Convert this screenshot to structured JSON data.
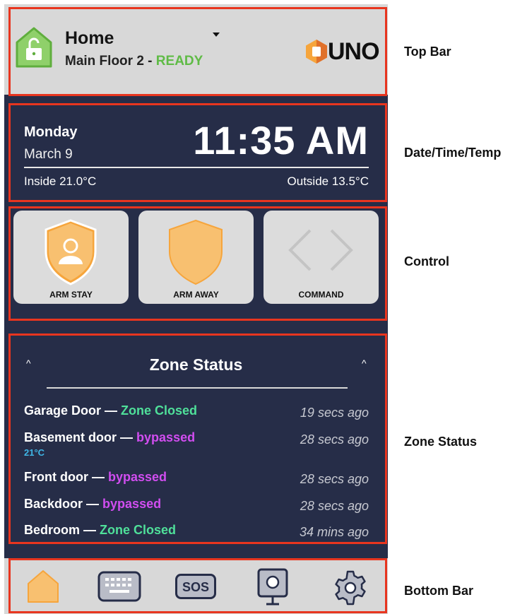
{
  "top_bar": {
    "location": "Home",
    "floor": "Main Floor 2",
    "separator": " - ",
    "status": "READY",
    "logo_text": "UNO",
    "lock_icon": "unlocked-home-icon",
    "accent_green": "#5fbb46"
  },
  "datetime": {
    "day": "Monday",
    "date": "March 9",
    "time": "11:35 AM",
    "inside": "Inside 21.0°C",
    "outside": "Outside 13.5°C"
  },
  "controls": [
    {
      "label": "ARM STAY",
      "icon": "shield-person-icon"
    },
    {
      "label": "ARM AWAY",
      "icon": "shield-icon"
    },
    {
      "label": "COMMAND",
      "icon": "chevrons-icon"
    }
  ],
  "zone_status": {
    "title": "Zone Status",
    "caret": "^",
    "rows": [
      {
        "name": "Garage Door",
        "dash": " — ",
        "status": "Zone Closed",
        "time": "19 secs ago"
      },
      {
        "name": "Basement door",
        "dash": " — ",
        "status": "bypassed",
        "time": "28 secs ago",
        "sub": "21°C"
      },
      {
        "name": "Front door",
        "dash": " — ",
        "status": "bypassed",
        "time": "28 secs ago"
      },
      {
        "name": "Backdoor",
        "dash": " — ",
        "status": "bypassed",
        "time": "28 secs ago"
      },
      {
        "name": "Bedroom",
        "dash": " — ",
        "status": "Zone Closed",
        "time": "34 mins ago"
      }
    ]
  },
  "bottom_bar": {
    "items": [
      "home-icon",
      "keypad-icon",
      "sos-icon",
      "camera-icon",
      "settings-icon"
    ],
    "sos_label": "SOS"
  },
  "callouts": {
    "top_bar": "Top Bar",
    "datetime": "Date/Time/Temp",
    "control": "Control",
    "zone_status": "Zone Status",
    "bottom_bar": "Bottom Bar"
  },
  "colors": {
    "panel_bg": "#262d48",
    "bar_bg": "#d8d8d8",
    "highlight_red": "#e8351f",
    "orange": "#f6a53c"
  }
}
